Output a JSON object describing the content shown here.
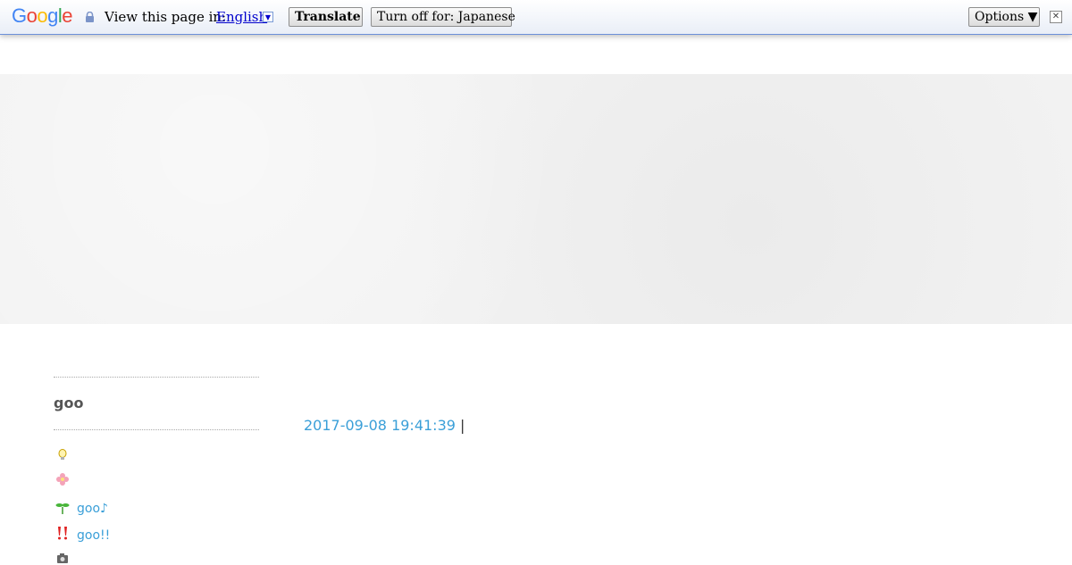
{
  "translate_bar": {
    "logo_letters": [
      "G",
      "o",
      "o",
      "g",
      "l",
      "e"
    ],
    "logo_colors": [
      "#4285f4",
      "#ea4335",
      "#fbbc05",
      "#4285f4",
      "#34a853",
      "#ea4335"
    ],
    "view_label": "View this page in:",
    "language": "English",
    "translate_label": "Translate",
    "turn_off_label": "Turn off for: Japanese",
    "options_label": "Options ▼",
    "close_label": "✕"
  },
  "sidebar": {
    "title": "goo",
    "items": [
      {
        "icon": "lightbulb-icon",
        "label": ""
      },
      {
        "icon": "flower-icon",
        "label": ""
      },
      {
        "icon": "sprout-icon",
        "label": "goo♪"
      },
      {
        "icon": "exclamation-icon",
        "label": "goo!!"
      },
      {
        "icon": "camera-icon",
        "label": ""
      }
    ]
  },
  "post": {
    "datetime": "2017-09-08 19:41:39",
    "separator": "|"
  },
  "colors": {
    "link": "#3a9fd8",
    "banner": "#f2f2f2"
  }
}
